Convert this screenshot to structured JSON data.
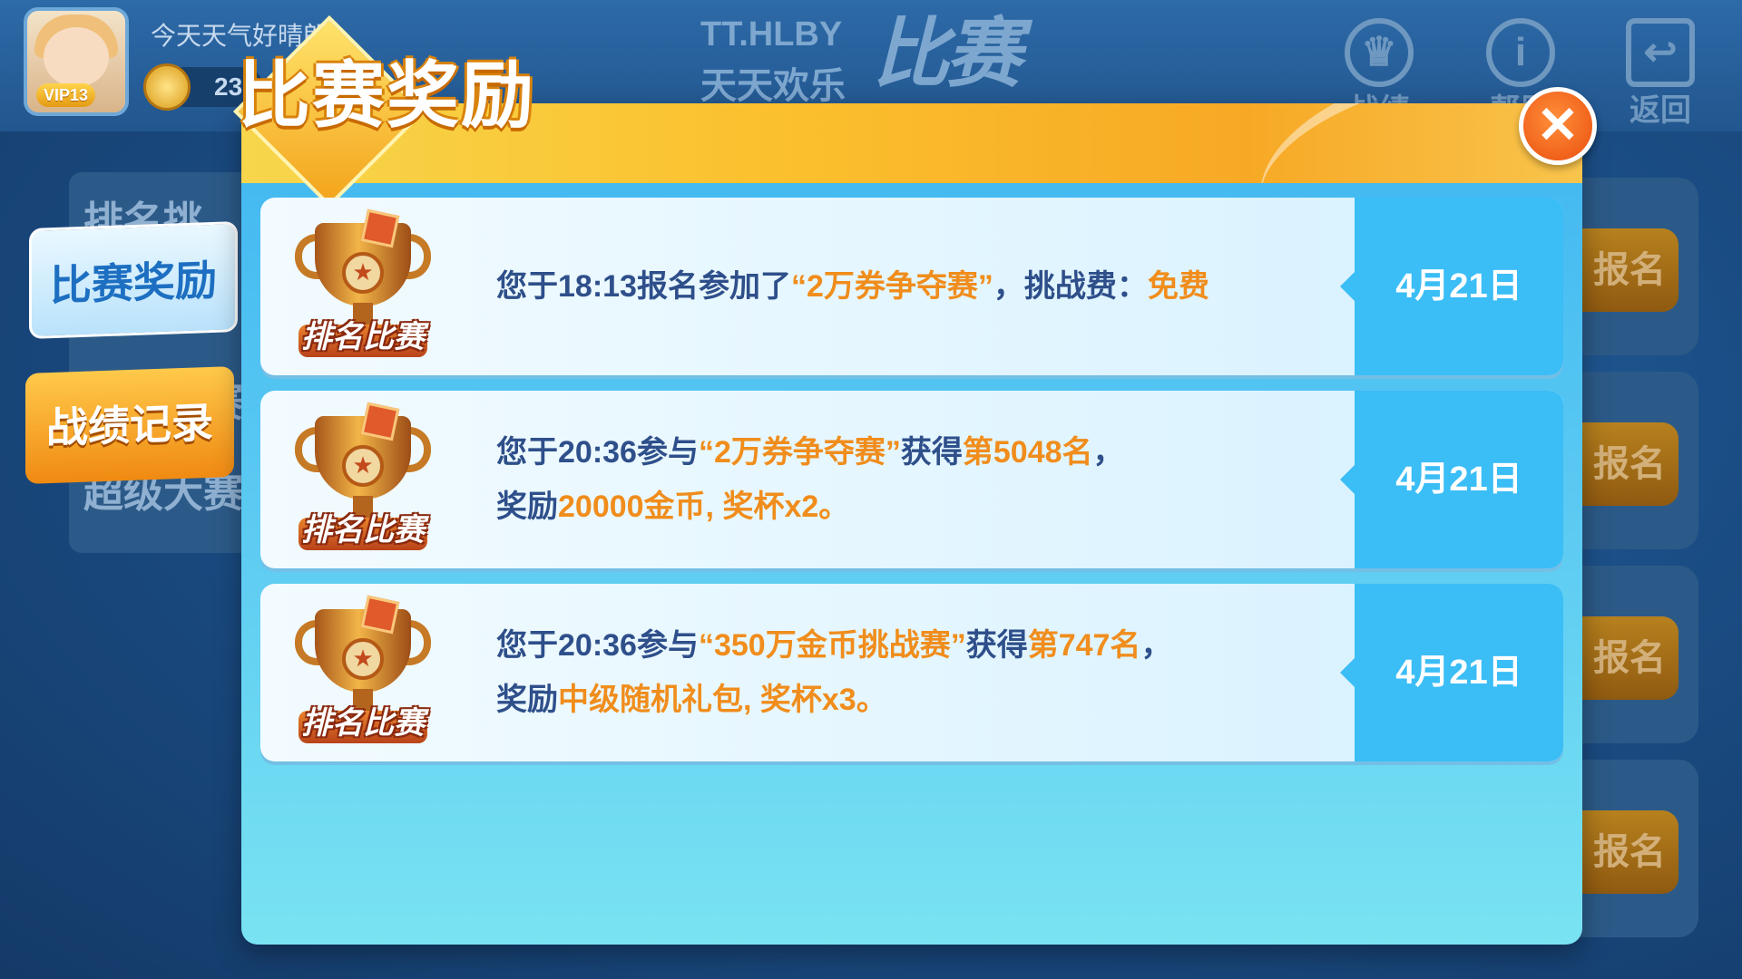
{
  "profile": {
    "nickname": "今天天气好晴朗",
    "vip": "VIP13",
    "coins": "23"
  },
  "logo": {
    "top": "TT.HLBY",
    "sub": "天天欢乐",
    "big": "比赛"
  },
  "top_nav": {
    "record_label": "战绩",
    "help_label": "帮助",
    "back_label": "返回"
  },
  "background_list": {
    "items": [
      "排名挑",
      "千元大赛",
      "超级大赛"
    ]
  },
  "background_register_label": "报名",
  "tabs": {
    "reward_label": "比赛奖励",
    "record_label": "战绩记录"
  },
  "modal": {
    "title": "比赛奖励",
    "close_icon": "close-icon"
  },
  "trophy_label": "排名比赛",
  "rewards": [
    {
      "line1": {
        "p1": "您于18:13报名参加了",
        "event": "“2万券争夺赛”",
        "p2": "，挑战费：",
        "fee": "免费"
      },
      "date": "4月21日"
    },
    {
      "line1": {
        "p1": "您于20:36参与",
        "event": "“2万券争夺赛”",
        "p2": "获得",
        "rank": "第5048名",
        "p3": "，"
      },
      "line2": {
        "p1": "奖励",
        "prize": "20000金币, 奖杯x2。"
      },
      "date": "4月21日"
    },
    {
      "line1": {
        "p1": "您于20:36参与",
        "event": "“350万金币挑战赛”",
        "p2": "获得",
        "rank": "第747名",
        "p3": "，"
      },
      "line2": {
        "p1": "奖励",
        "prize": "中级随机礼包, 奖杯x3。"
      },
      "date": "4月21日"
    }
  ],
  "colors": {
    "highlight": "#f08d1c",
    "text": "#2e4f8a",
    "date_pane": "#3bbdf6",
    "header": "#fbc02d"
  }
}
